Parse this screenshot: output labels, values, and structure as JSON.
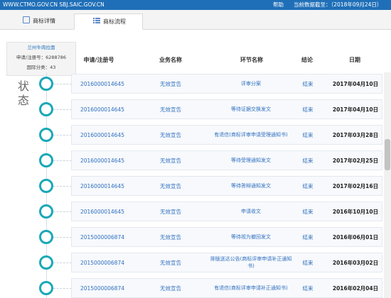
{
  "topbar": {
    "sites": "WWW.CTMO.GOV.CN SBJ.SAIC.GOV.CN",
    "help": "帮助",
    "data_cutoff": "当前数据截至：（2018年09月24日）"
  },
  "tabs": [
    {
      "label": "商标详情",
      "icon": "document-icon"
    },
    {
      "label": "商标流程",
      "icon": "list-icon"
    }
  ],
  "trademark": {
    "name": "兰州牛肉拉面",
    "reg_line": "申请/注册号：6288786",
    "class_line": "国际分类：43"
  },
  "status_label": [
    "状",
    "态"
  ],
  "columns": [
    "申请/注册号",
    "业务名称",
    "环节名称",
    "结论",
    "日期"
  ],
  "rows": [
    {
      "no": "2016000014645",
      "biz": "无效宣告",
      "step": "评审分案",
      "concl": "结束",
      "date": "2017年04月10日"
    },
    {
      "no": "2016000014645",
      "biz": "无效宣告",
      "step": "等待证据交换发文",
      "concl": "结束",
      "date": "2017年04月10日"
    },
    {
      "no": "2016000014645",
      "biz": "无效宣告",
      "step": "有退信(商标评审申请受理通知书)",
      "concl": "结束",
      "date": "2017年03月28日"
    },
    {
      "no": "2016000014645",
      "biz": "无效宣告",
      "step": "等待受理通知发文",
      "concl": "结束",
      "date": "2017年02月25日"
    },
    {
      "no": "2016000014645",
      "biz": "无效宣告",
      "step": "等待答辩通知发文",
      "concl": "结束",
      "date": "2017年02月16日"
    },
    {
      "no": "2016000014645",
      "biz": "无效宣告",
      "step": "申请收文",
      "concl": "结束",
      "date": "2016年10月10日"
    },
    {
      "no": "2015000006874",
      "biz": "无效宣告",
      "step": "等待视为撤回发文",
      "concl": "结束",
      "date": "2016年06月01日"
    },
    {
      "no": "2015000006874",
      "biz": "无效宣告",
      "step": "排版送达公告(商标评审申请补正通知书)",
      "concl": "结束",
      "date": "2016年03月02日"
    },
    {
      "no": "2015000006874",
      "biz": "无效宣告",
      "step": "有退信(商标评审申请补正通知书)",
      "concl": "结束",
      "date": "2016年02月04日"
    }
  ]
}
